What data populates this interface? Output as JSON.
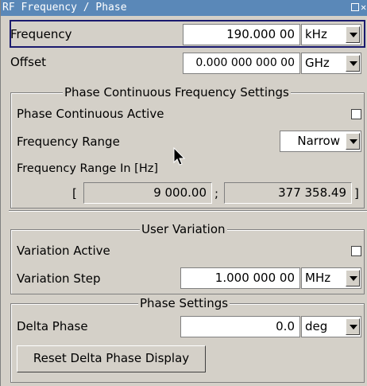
{
  "window": {
    "title": "RF Frequency / Phase"
  },
  "frequency": {
    "label": "Frequency",
    "value": "190.000 00",
    "unit": "kHz"
  },
  "offset": {
    "label": "Offset",
    "value": "0.000 000 000 00",
    "unit": "GHz"
  },
  "phase_continuous": {
    "group_title": "Phase Continuous Frequency Settings",
    "active_label": "Phase Continuous Active",
    "active_checked": false,
    "range_label": "Frequency Range",
    "range_value": "Narrow",
    "range_hz_label": "Frequency Range In [Hz]",
    "bracket_open": "[",
    "separator": ";",
    "bracket_close": "]",
    "range_min": "9 000.00",
    "range_max": "377 358.49"
  },
  "user_variation": {
    "group_title": "User Variation",
    "active_label": "Variation Active",
    "active_checked": false,
    "step_label": "Variation Step",
    "step_value": "1.000 000 00",
    "step_unit": "MHz"
  },
  "phase_settings": {
    "group_title": "Phase Settings",
    "delta_label": "Delta Phase",
    "delta_value": "0.0",
    "delta_unit": "deg",
    "reset_button": "Reset Delta Phase Display"
  }
}
